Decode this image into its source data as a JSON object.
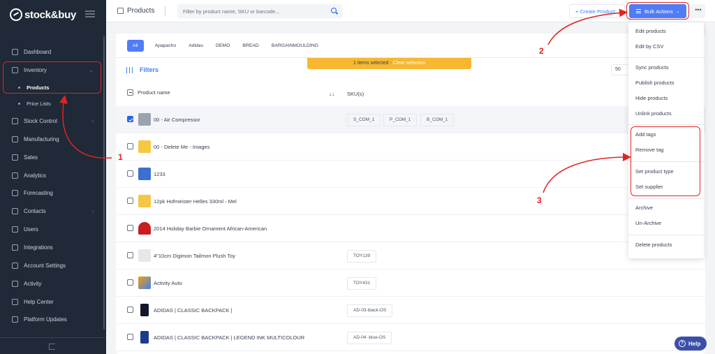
{
  "brand": {
    "name": "stock&buy"
  },
  "sidebar": {
    "items": [
      {
        "label": "Dashboard"
      },
      {
        "label": "Inventory"
      },
      {
        "label": "Stock Control"
      },
      {
        "label": "Manufacturing"
      },
      {
        "label": "Sales"
      },
      {
        "label": "Analytics"
      },
      {
        "label": "Forecasting"
      },
      {
        "label": "Contacts"
      },
      {
        "label": "Users"
      },
      {
        "label": "Integrations"
      },
      {
        "label": "Account Settings"
      },
      {
        "label": "Activity"
      },
      {
        "label": "Help Center"
      },
      {
        "label": "Platform Updates"
      }
    ],
    "sub_items": [
      {
        "label": "Products"
      },
      {
        "label": "Price Lists"
      }
    ]
  },
  "header": {
    "title": "Products",
    "search_placeholder": "Filter by product name, SKU or barcode...",
    "create_label": "+ Create Product",
    "bulk_label": "Bulk Actions",
    "more_label": "•••"
  },
  "tabs": [
    "All",
    "Apapacho",
    "Adidas",
    "DEMO",
    "BREAD",
    "BARGAINMOULDING"
  ],
  "banner": {
    "text": "1 items selected - ",
    "clear": "Clear selection"
  },
  "filters": {
    "label": "Filters",
    "per_page": "50"
  },
  "table": {
    "columns": {
      "name": "Product name",
      "sku": "SKU(s)"
    },
    "rows": [
      {
        "name": "00 - Air Compressor",
        "skus": [
          "S_COM_1",
          "P_COM_1",
          "B_COM_1"
        ]
      },
      {
        "name": "00 - Delete Me - Images",
        "skus": []
      },
      {
        "name": "1233",
        "skus": []
      },
      {
        "name": "12pk Hofmeister Helles 330ml - Mel",
        "skus": []
      },
      {
        "name": "2014 Holiday Barbie Ornament African-American",
        "skus": []
      },
      {
        "name": "4\"10cm Digimon Tailmon Plush Toy",
        "skus": [
          "TOY139"
        ]
      },
      {
        "name": "Activity Auto",
        "skus": [
          "TOY431"
        ]
      },
      {
        "name": "ADIDAS | CLASSIC BACKPACK |",
        "skus": [
          "AD-03-black-OS"
        ]
      },
      {
        "name": "ADIDAS | CLASSIC BACKPACK | LEGEND INK MULTICOLOUR",
        "skus": [
          "AD-04 -blue-OS"
        ]
      }
    ]
  },
  "bulk_menu": {
    "items": [
      "Edit products",
      "Edit by CSV",
      "Sync products",
      "Publish products",
      "Hide products",
      "Unlink products",
      "Add tags",
      "Remove tag",
      "Set product type",
      "Set supplier",
      "Archive",
      "Un-Archive",
      "Delete products"
    ]
  },
  "annotations": [
    "1",
    "2",
    "3"
  ],
  "help": {
    "label": "Help"
  },
  "colors": {
    "accent": "#4f7cf7",
    "annotation": "#e02424",
    "banner": "#f7b731",
    "sidebar": "#1f2937"
  }
}
